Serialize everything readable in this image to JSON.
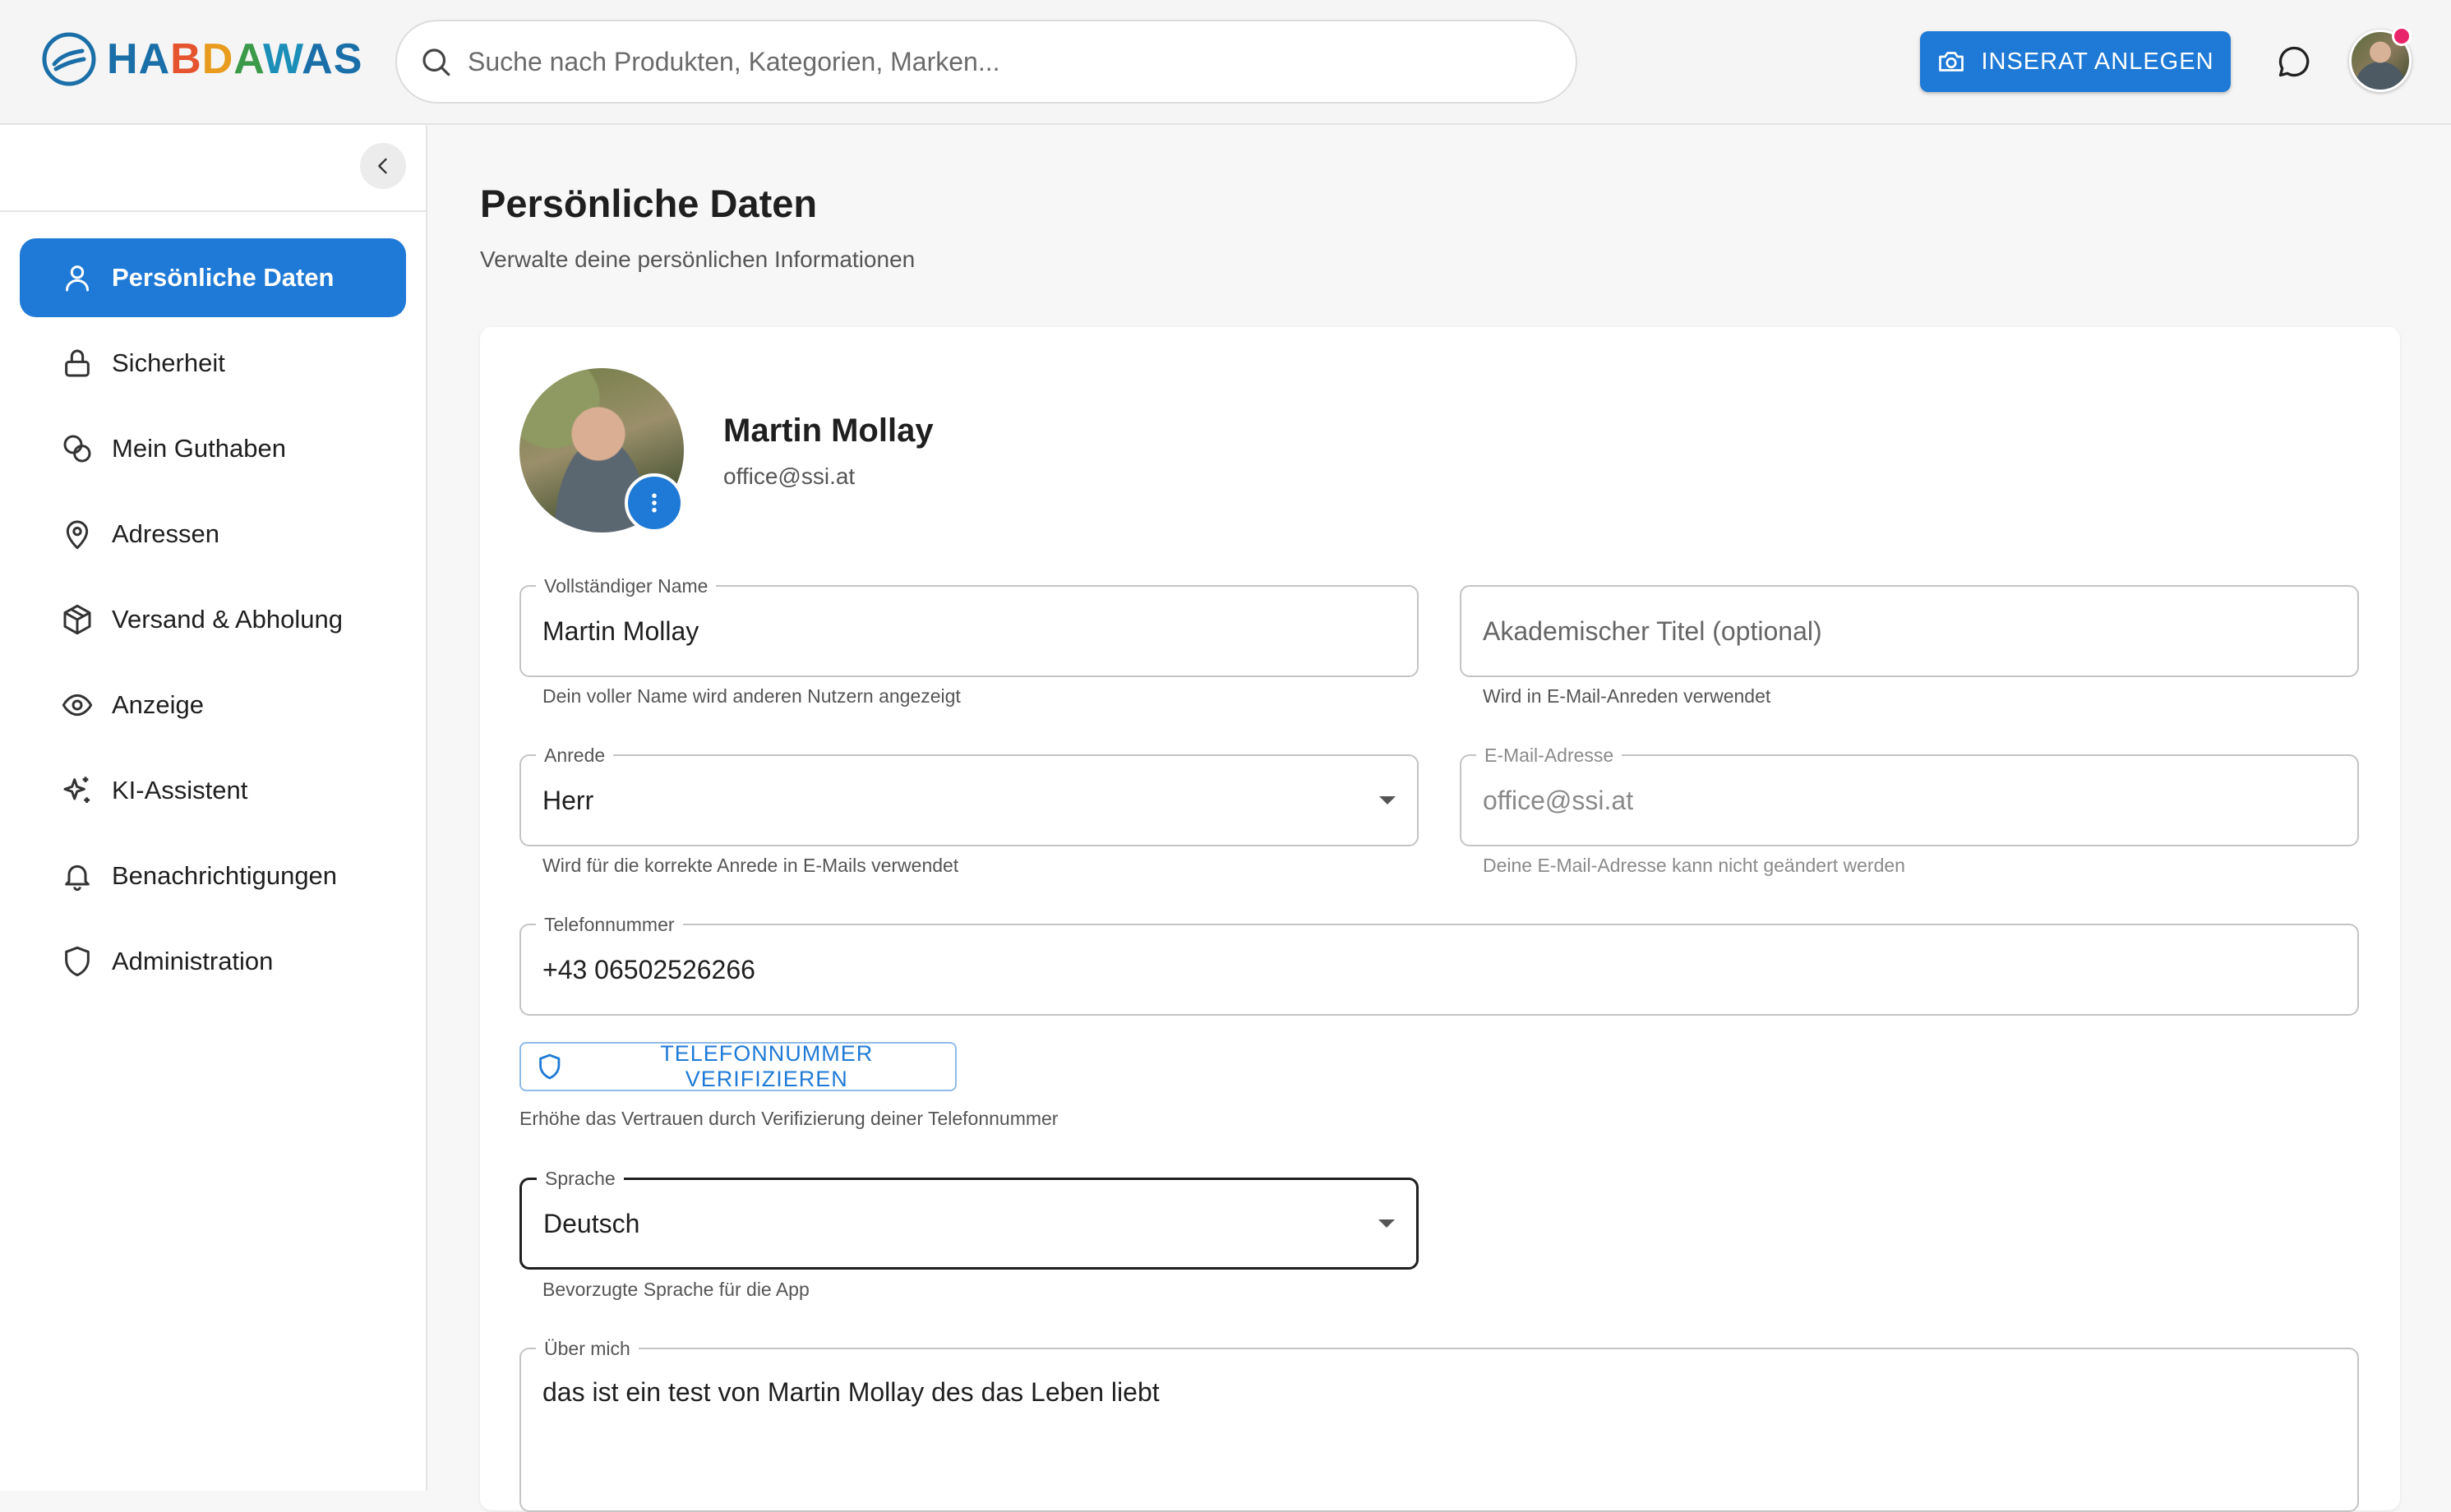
{
  "header": {
    "logo_text": "HABDAWAS",
    "search_placeholder": "Suche nach Produkten, Kategorien, Marken...",
    "create_listing_label": "INSERAT ANLEGEN"
  },
  "sidebar": {
    "items": [
      {
        "label": "Persönliche Daten",
        "icon": "user-icon",
        "active": true
      },
      {
        "label": "Sicherheit",
        "icon": "lock-icon"
      },
      {
        "label": "Mein Guthaben",
        "icon": "coins-icon"
      },
      {
        "label": "Adressen",
        "icon": "map-pin-icon"
      },
      {
        "label": "Versand & Abholung",
        "icon": "package-icon"
      },
      {
        "label": "Anzeige",
        "icon": "eye-icon"
      },
      {
        "label": "KI-Assistent",
        "icon": "sparkles-icon"
      },
      {
        "label": "Benachrichtigungen",
        "icon": "bell-icon"
      },
      {
        "label": "Administration",
        "icon": "shield-icon"
      }
    ]
  },
  "page": {
    "title": "Persönliche Daten",
    "subtitle": "Verwalte deine persönlichen Informationen"
  },
  "profile": {
    "name": "Martin Mollay",
    "email": "office@ssi.at"
  },
  "form": {
    "full_name": {
      "label": "Vollständiger Name",
      "value": "Martin Mollay",
      "helper": "Dein voller Name wird anderen Nutzern angezeigt"
    },
    "academic_title": {
      "placeholder": "Akademischer Titel (optional)",
      "helper": "Wird in E-Mail-Anreden verwendet"
    },
    "salutation": {
      "label": "Anrede",
      "value": "Herr",
      "helper": "Wird für die korrekte Anrede in E-Mails verwendet"
    },
    "email": {
      "label": "E-Mail-Adresse",
      "value": "office@ssi.at",
      "helper": "Deine E-Mail-Adresse kann nicht geändert werden"
    },
    "phone": {
      "label": "Telefonnummer",
      "value": "+43 06502526266"
    },
    "verify_phone_label": "TELEFONNUMMER VERIFIZIEREN",
    "verify_phone_helper": "Erhöhe das Vertrauen durch Verifizierung deiner Telefonnummer",
    "language": {
      "label": "Sprache",
      "value": "Deutsch",
      "helper": "Bevorzugte Sprache für die App"
    },
    "about": {
      "label": "Über mich",
      "value": "das ist ein test von Martin Mollay des das Leben liebt"
    }
  },
  "colors": {
    "accent": "#1e7ad6",
    "notification": "#e8246a"
  }
}
